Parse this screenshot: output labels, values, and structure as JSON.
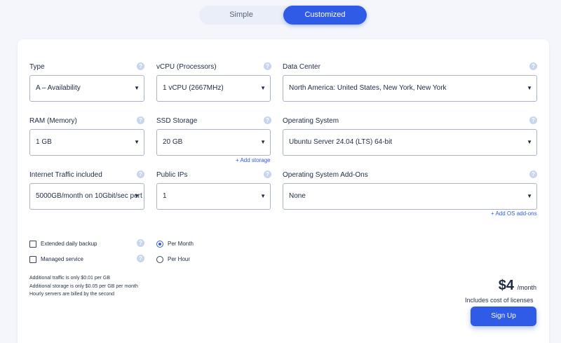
{
  "mode_toggle": {
    "simple_label": "Simple",
    "customized_label": "Customized",
    "selected": "Customized"
  },
  "fields": {
    "type": {
      "label": "Type",
      "value": "A – Availability"
    },
    "vcpu": {
      "label": "vCPU (Processors)",
      "value": "1 vCPU (2667MHz)"
    },
    "datacenter": {
      "label": "Data Center",
      "value": "North America: United States, New York, New York"
    },
    "ram": {
      "label": "RAM (Memory)",
      "value": "1 GB"
    },
    "ssd": {
      "label": "SSD Storage",
      "value": "20 GB",
      "add_link": "+ Add storage"
    },
    "os": {
      "label": "Operating System",
      "value": "Ubuntu Server 24.04 (LTS) 64-bit"
    },
    "traffic": {
      "label": "Internet Traffic included",
      "value": "5000GB/month on 10Gbit/sec port"
    },
    "ips": {
      "label": "Public IPs",
      "value": "1"
    },
    "os_addons": {
      "label": "Operating System Add-Ons",
      "value": "None",
      "add_link": "+ Add OS add-ons"
    }
  },
  "help_icon_glyph": "?",
  "options": {
    "backup": {
      "label": "Extended daily backup",
      "checked": false
    },
    "managed": {
      "label": "Managed service",
      "checked": false
    }
  },
  "billing": {
    "per_month": "Per Month",
    "per_hour": "Per Hour",
    "selected": "Per Month"
  },
  "notes": [
    "Additional traffic is only $0.01 per GB",
    "Additional storage is only $0.05 per GB per month",
    "Hourly servers are billed by the second"
  ],
  "price": {
    "amount": "$4",
    "period": "/month",
    "licenses": "Includes cost of licenses"
  },
  "signup_label": "Sign Up",
  "colors": {
    "accent": "#2f5be7",
    "help_icon": "#c9d4f0",
    "border": "#a9b4cc"
  }
}
